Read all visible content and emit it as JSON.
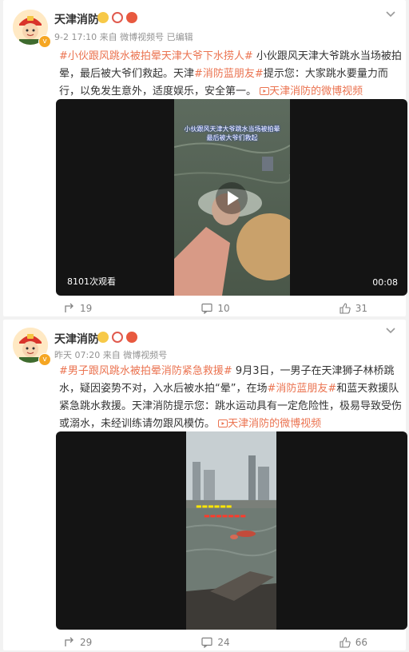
{
  "colors": {
    "accent": "#eb7350",
    "text": "#333333",
    "meta": "#939393",
    "background": "#f2f2f2"
  },
  "posts": [
    {
      "username": "天津消防",
      "meta": "9-2 17:10 来自 微博视频号 已编辑",
      "hashtag": "#小伙跟风跳水被拍晕天津大爷下水捞人#",
      "body_1": " 小伙跟风天津大爷跳水当场被拍晕，最后被大爷们救起。天津",
      "mention": "#消防蓝朋友#",
      "body_2": "提示您：大家跳水要量力而行，以免发生意外，适度娱乐，安全第一。",
      "video_link": "天津消防的微博视频",
      "video": {
        "views": "8101次观看",
        "duration": "00:08",
        "caption": "小伙跟风天津大爷跳水当场被拍晕\n最后被大爷们救起"
      },
      "actions": {
        "repost": "19",
        "comment": "10",
        "like": "31"
      }
    },
    {
      "username": "天津消防",
      "meta": "昨天 07:20 来自 微博视频号",
      "hashtag": "#男子跟风跳水被拍晕消防紧急救援#",
      "body_1": " 9月3日，一男子在天津狮子林桥跳水，疑因姿势不对，入水后被水拍“晕”，在场",
      "mention": "#消防蓝朋友#",
      "body_2": "和蓝天救援队紧急跳水救援。天津消防提示您：跳水运动具有一定危险性，极易导致受伤或溺水，未经训练请勿跟风模仿。",
      "video_link": "天津消防的微博视频",
      "actions": {
        "repost": "29",
        "comment": "24",
        "like": "66"
      }
    }
  ]
}
